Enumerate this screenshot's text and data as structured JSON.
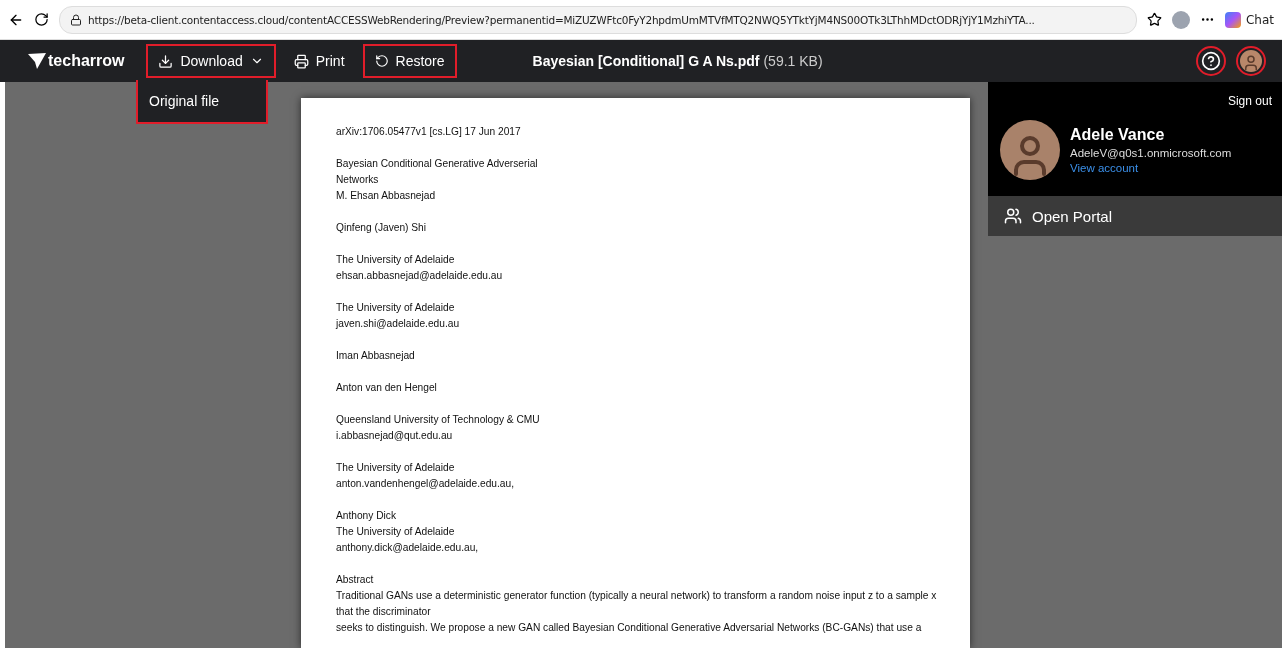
{
  "browser": {
    "url": "https://beta-client.contentaccess.cloud/contentACCESSWebRendering/Preview?permanentid=MiZUZWFtc0FyY2hpdmUmMTVfMTQ2NWQ5YTktYjM4NS00OTk3LThhMDctODRjYjY1MzhiYTA...",
    "chat": "Chat"
  },
  "toolbar": {
    "logo": "techarrow",
    "actions": [
      {
        "kind": "menu",
        "label": "Download",
        "highlighted": true,
        "expanded": true,
        "menu_items": [
          "Original file"
        ]
      },
      {
        "kind": "button",
        "label": "Print",
        "highlighted": false
      },
      {
        "kind": "button",
        "label": "Restore",
        "highlighted": true
      }
    ],
    "file_name": "Bayesian [Conditional] G A Ns.pdf",
    "file_size": "(59.1 KB)",
    "help_highlighted": true,
    "avatar_highlighted": true
  },
  "document": {
    "paragraphs": [
      [
        "arXiv:1706.05477v1 [cs.LG] 17 Jun 2017"
      ],
      [
        "Bayesian Conditional Generative Adverserial",
        "Networks",
        "M. Ehsan Abbasnejad"
      ],
      [
        "Qinfeng (Javen) Shi"
      ],
      [
        "The University of Adelaide",
        "ehsan.abbasnejad@adelaide.edu.au"
      ],
      [
        "The University of Adelaide",
        "javen.shi@adelaide.edu.au"
      ],
      [
        "Iman Abbasnejad"
      ],
      [
        "Anton van den Hengel"
      ],
      [
        "Queensland University of Technology & CMU",
        "i.abbasnejad@qut.edu.au"
      ],
      [
        "The University of Adelaide",
        "anton.vandenhengel@adelaide.edu.au,"
      ],
      [
        "Anthony Dick",
        "The University of Adelaide",
        "anthony.dick@adelaide.edu.au,"
      ],
      [
        "Abstract",
        "Traditional GANs use a deterministic generator function (typically a neural network) to transform a random noise input z to a sample x",
        "that the discriminator",
        "seeks to distinguish. We propose a new GAN called Bayesian Conditional Generative Adversarial Networks (BC-GANs) that use a"
      ]
    ]
  },
  "account": {
    "sign_out": "Sign out",
    "name": "Adele Vance",
    "email": "AdeleV@q0s1.onmicrosoft.com",
    "view_account": "View account",
    "portal": "Open Portal"
  }
}
